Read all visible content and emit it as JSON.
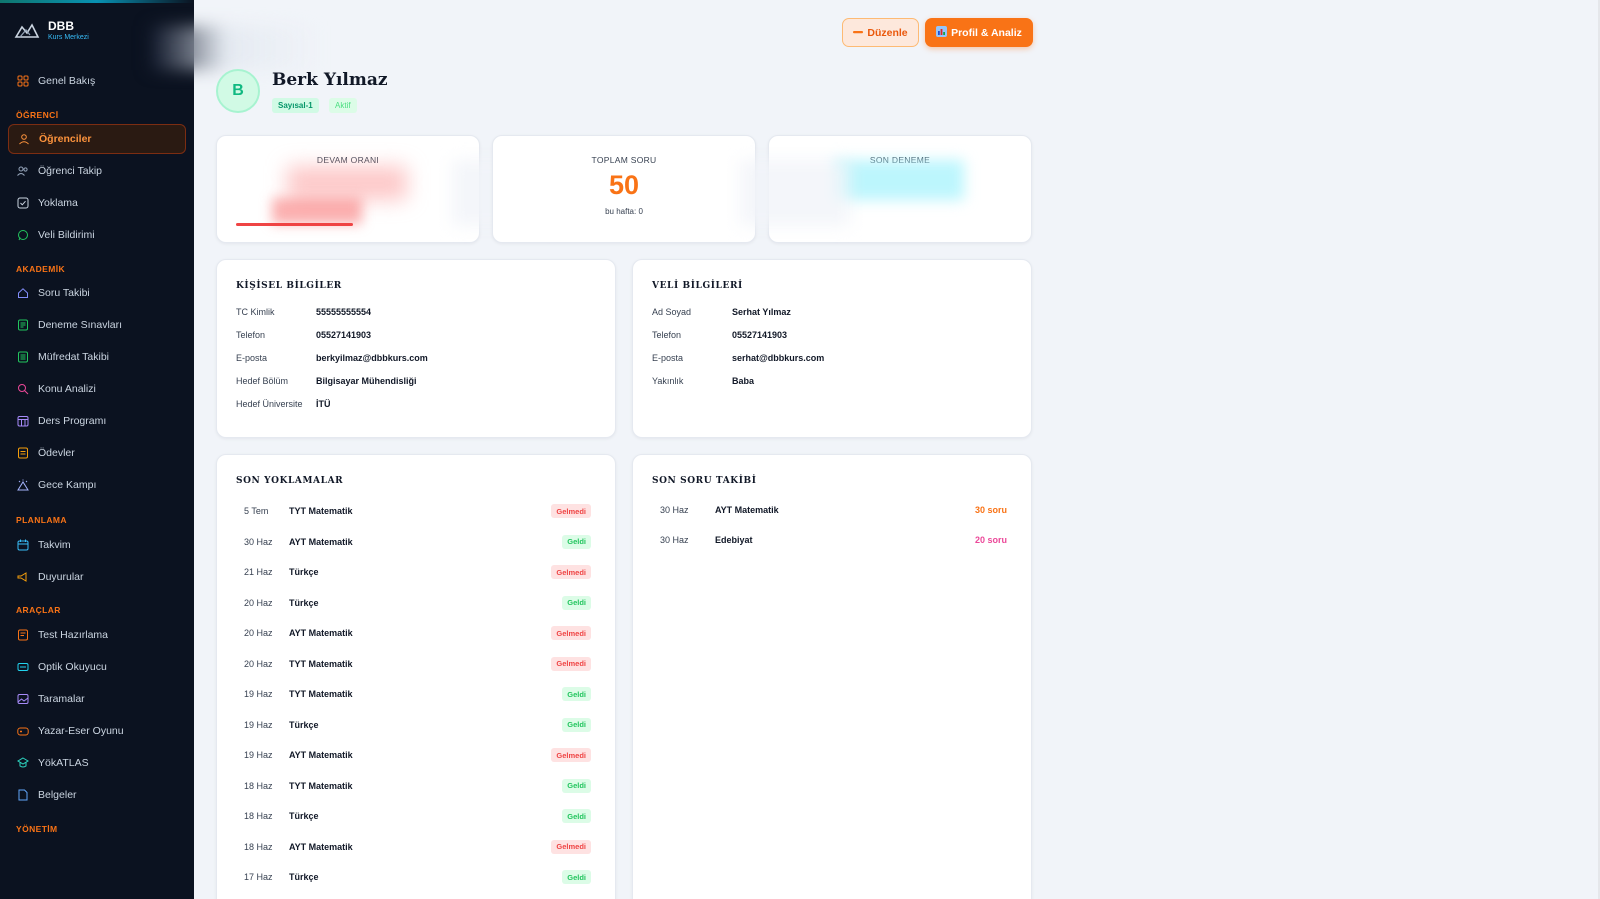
{
  "brand": {
    "name": "DBB",
    "subtitle": "Kurs Merkezi"
  },
  "sidebar": {
    "overview": "Genel Bakış",
    "sections": {
      "ogrenci": "ÖĞRENCİ",
      "akademik": "AKADEMİK",
      "planlama": "PLANLAMA",
      "araclar": "ARAÇLAR",
      "yonetim": "YÖNETİM"
    },
    "items": {
      "ogrenciler": "Öğrenciler",
      "ogrenci_takip": "Öğrenci Takip",
      "yoklama": "Yoklama",
      "veli_bildirimi": "Veli Bildirimi",
      "soru_takibi": "Soru Takibi",
      "deneme_sinavlari": "Deneme Sınavları",
      "mufredat_takibi": "Müfredat Takibi",
      "konu_analizi": "Konu Analizi",
      "ders_programi": "Ders Programı",
      "odevler": "Ödevler",
      "gece_kampi": "Gece Kampı",
      "takvim": "Takvim",
      "duyurular": "Duyurular",
      "test_hazirlama": "Test Hazırlama",
      "optik_okuyucu": "Optik Okuyucu",
      "taramalar": "Taramalar",
      "yazar_eser": "Yazar-Eser Oyunu",
      "yokatlas": "YökATLAS",
      "belgeler": "Belgeler"
    }
  },
  "header": {
    "edit_label": "Düzenle",
    "profile_label": "Profil & Analiz"
  },
  "student": {
    "initial": "B",
    "name": "Berk Yılmaz",
    "group": "Sayısal-1",
    "status": "Aktif"
  },
  "stats": {
    "attendance_label": "DEVAM ORANI",
    "attendance_fill": 0.52,
    "total_label": "TOPLAM SORU",
    "total_value": "50",
    "total_sub": "bu hafta: 0",
    "last_exam_label": "SON DENEME"
  },
  "personal": {
    "title": "KİŞİSEL BİLGİLER",
    "tc_label": "TC Kimlik",
    "tc": "55555555554",
    "phone_label": "Telefon",
    "phone": "05527141903",
    "email_label": "E-posta",
    "email": "berkyilmaz@dbbkurs.com",
    "dept_label": "Hedef Bölüm",
    "dept": "Bilgisayar Mühendisliği",
    "uni_label": "Hedef Üniversite",
    "uni": "İTÜ"
  },
  "parent": {
    "title": "VELİ BİLGİLERİ",
    "name_label": "Ad Soyad",
    "name": "Serhat Yılmaz",
    "phone_label": "Telefon",
    "phone": "05527141903",
    "email_label": "E-posta",
    "email": "serhat@dbbkurs.com",
    "relation_label": "Yakınlık",
    "relation": "Baba"
  },
  "attendance": {
    "title": "SON YOKLAMALAR",
    "rows": [
      {
        "date": "5 Tem",
        "subject": "TYT Matematik",
        "status": "Gelmedi"
      },
      {
        "date": "30 Haz",
        "subject": "AYT Matematik",
        "status": "Geldi"
      },
      {
        "date": "21 Haz",
        "subject": "Türkçe",
        "status": "Gelmedi"
      },
      {
        "date": "20 Haz",
        "subject": "Türkçe",
        "status": "Geldi"
      },
      {
        "date": "20 Haz",
        "subject": "AYT Matematik",
        "status": "Gelmedi"
      },
      {
        "date": "20 Haz",
        "subject": "TYT Matematik",
        "status": "Gelmedi"
      },
      {
        "date": "19 Haz",
        "subject": "TYT Matematik",
        "status": "Geldi"
      },
      {
        "date": "19 Haz",
        "subject": "Türkçe",
        "status": "Geldi"
      },
      {
        "date": "19 Haz",
        "subject": "AYT Matematik",
        "status": "Gelmedi"
      },
      {
        "date": "18 Haz",
        "subject": "TYT Matematik",
        "status": "Geldi"
      },
      {
        "date": "18 Haz",
        "subject": "Türkçe",
        "status": "Geldi"
      },
      {
        "date": "18 Haz",
        "subject": "AYT Matematik",
        "status": "Gelmedi"
      },
      {
        "date": "17 Haz",
        "subject": "Türkçe",
        "status": "Geldi"
      }
    ]
  },
  "questions": {
    "title": "SON SORU TAKİBİ",
    "rows": [
      {
        "date": "30 Haz",
        "subject": "AYT Matematik",
        "count": "30 soru",
        "color": "#f97316"
      },
      {
        "date": "30 Haz",
        "subject": "Edebiyat",
        "count": "20 soru",
        "color": "#ec4899"
      }
    ]
  },
  "colors": {
    "accent": "#f97316",
    "sidebar_bg": "#0b1220",
    "absent": "#ef4444",
    "present": "#22c55e"
  }
}
